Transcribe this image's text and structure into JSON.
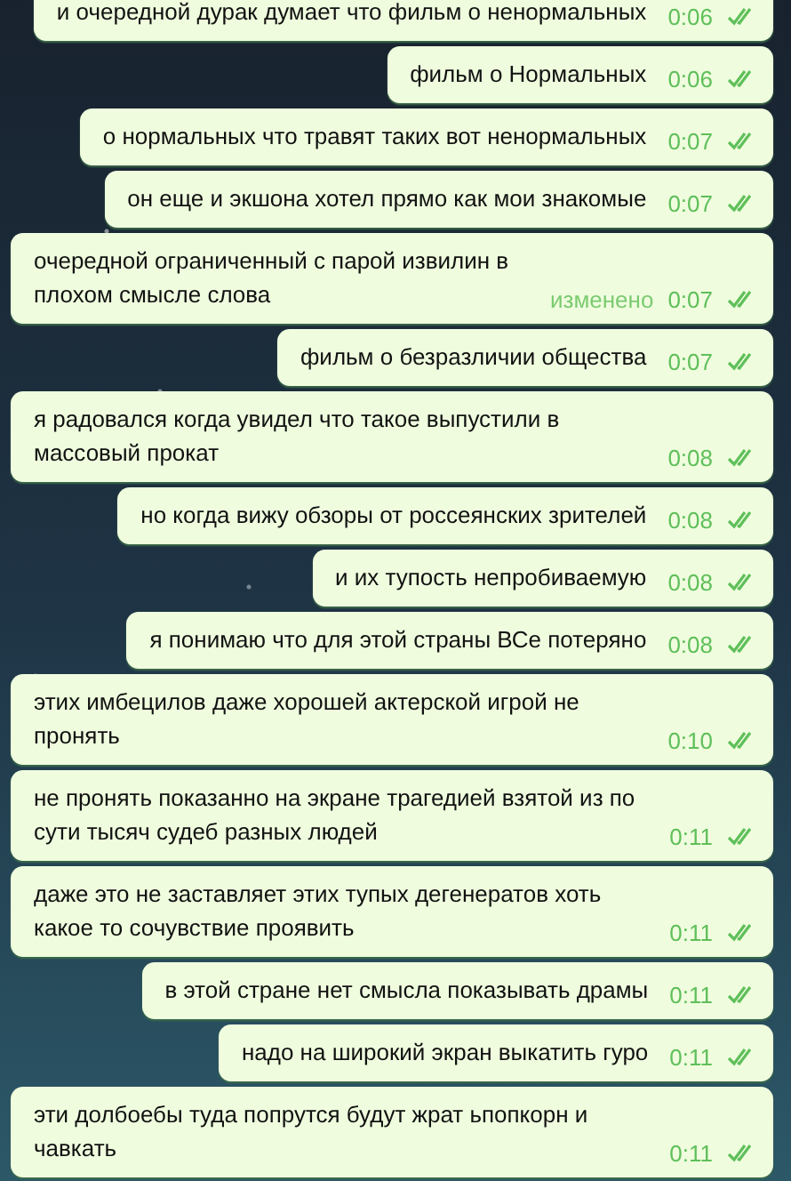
{
  "messages": [
    {
      "text": "и очередной дурак думает что фильм о ненормальных",
      "time": "0:06",
      "read": true
    },
    {
      "text": "фильм о Нормальных",
      "time": "0:06",
      "read": true
    },
    {
      "text": "о нормальных что травят таких вот ненормальных",
      "time": "0:07",
      "read": true
    },
    {
      "text": "он еще и экшона хотел прямо как мои знакомые",
      "time": "0:07",
      "read": true
    },
    {
      "text": "очередной ограниченный с парой извилин в плохом смысле слова",
      "edited": "изменено",
      "time": "0:07",
      "read": true
    },
    {
      "text": "фильм о безразличии общества",
      "time": "0:07",
      "read": true
    },
    {
      "text": "я радовался когда увидел что такое выпустили в массовый прокат",
      "time": "0:08",
      "read": true
    },
    {
      "text": "но когда вижу обзоры от россеянских зрителей",
      "time": "0:08",
      "read": true
    },
    {
      "text": "и их тупость непробиваемую",
      "time": "0:08",
      "read": true
    },
    {
      "text": "я понимаю что для этой страны ВСе потеряно",
      "time": "0:08",
      "read": true
    },
    {
      "text": "этих имбецилов даже хорошей актерской  игрой не пронять",
      "time": "0:10",
      "read": true
    },
    {
      "text": "не пронять показанно на экране трагедией взятой из по сути тысяч судеб разных людей",
      "time": "0:11",
      "read": true
    },
    {
      "text": "даже это не заставляет этих тупых дегенератов хоть какое то сочувствие проявить",
      "time": "0:11",
      "read": true
    },
    {
      "text": "в этой стране нет смысла показывать драмы",
      "time": "0:11",
      "read": true
    },
    {
      "text": "надо на широкий экран выкатить гуро",
      "time": "0:11",
      "read": true
    },
    {
      "text": "эти долбоебы туда попрутся будут жрат ьпопкорн и чавкать",
      "time": "0:11",
      "read": true
    }
  ]
}
